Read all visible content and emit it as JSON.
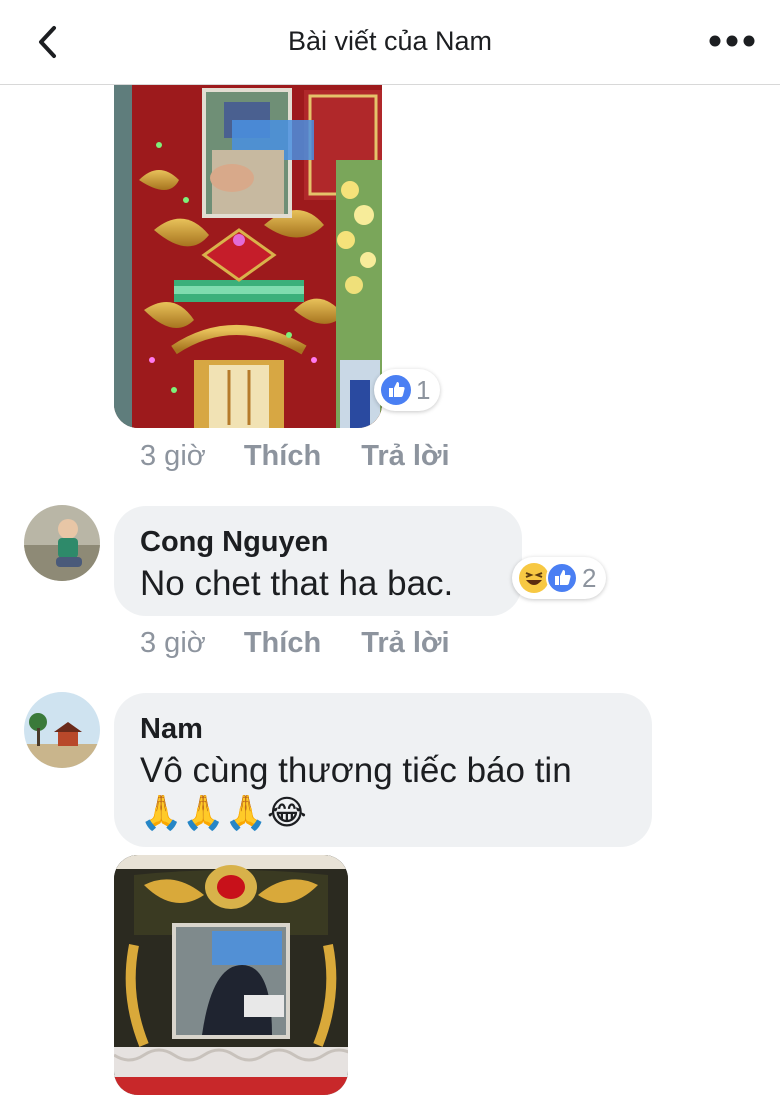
{
  "header": {
    "title": "Bài viết của Nam",
    "back_icon": "chevron-left-icon",
    "more_icon": "more-dots-icon"
  },
  "post_photo_1": {
    "reactions": {
      "icons": [
        "like-icon"
      ],
      "count": "1"
    },
    "meta": {
      "time": "3 giờ",
      "like": "Thích",
      "reply": "Trả lời"
    }
  },
  "comments": [
    {
      "author": "Cong Nguyen",
      "text": "No chet that ha bac.",
      "reactions": {
        "icons": [
          "haha-icon",
          "like-icon"
        ],
        "count": "2"
      },
      "meta": {
        "time": "3 giờ",
        "like": "Thích",
        "reply": "Trả lời"
      }
    },
    {
      "author": "Nam",
      "text": "Vô cùng thương tiếc báo tin",
      "emoji_line": "🙏🙏🙏😂"
    }
  ],
  "colors": {
    "bubble_bg": "#eff1f3",
    "meta_gray": "#8d949e",
    "like_blue": "#4a7ff3",
    "haha_yellow": "#f7c843"
  }
}
